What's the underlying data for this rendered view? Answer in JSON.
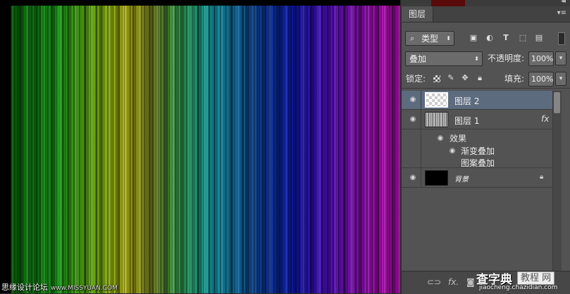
{
  "canvas": {
    "watermark": "思缘设计论坛",
    "watermark_url": "www.MISSYUAN.COM"
  },
  "layers_panel": {
    "tab_label": "图层",
    "menu_icon": "panel-menu-icon",
    "filter": {
      "kind_label": "类型",
      "icons": [
        "image-filter-icon",
        "adjustment-filter-icon",
        "type-filter-icon",
        "shape-filter-icon",
        "smart-object-filter-icon"
      ]
    },
    "blend_mode": "叠加",
    "opacity_label": "不透明度:",
    "opacity_value": "100%",
    "lock_label": "锁定:",
    "fill_label": "填充:",
    "fill_value": "100%",
    "layers": [
      {
        "name": "图层 2",
        "selected": true,
        "thumb": "transparent"
      },
      {
        "name": "图层 1",
        "selected": false,
        "thumb": "stripes",
        "fx": "fx"
      },
      {
        "name": "背景",
        "selected": false,
        "thumb": "black",
        "locked": true
      }
    ],
    "effects_label": "效果",
    "effects": [
      "渐变叠加",
      "图案叠加"
    ]
  },
  "bottom_bar": {
    "icons": [
      "link-icon",
      "fx-icon",
      "mask-icon"
    ]
  },
  "site_watermark": {
    "brand": "查字典",
    "box": "教程 网",
    "url": "jiaocheng.chazidian.com"
  },
  "colors": {
    "panel_bg": "#535353",
    "selected_row": "#5c6b7e",
    "canvas_bg": "#000000"
  }
}
